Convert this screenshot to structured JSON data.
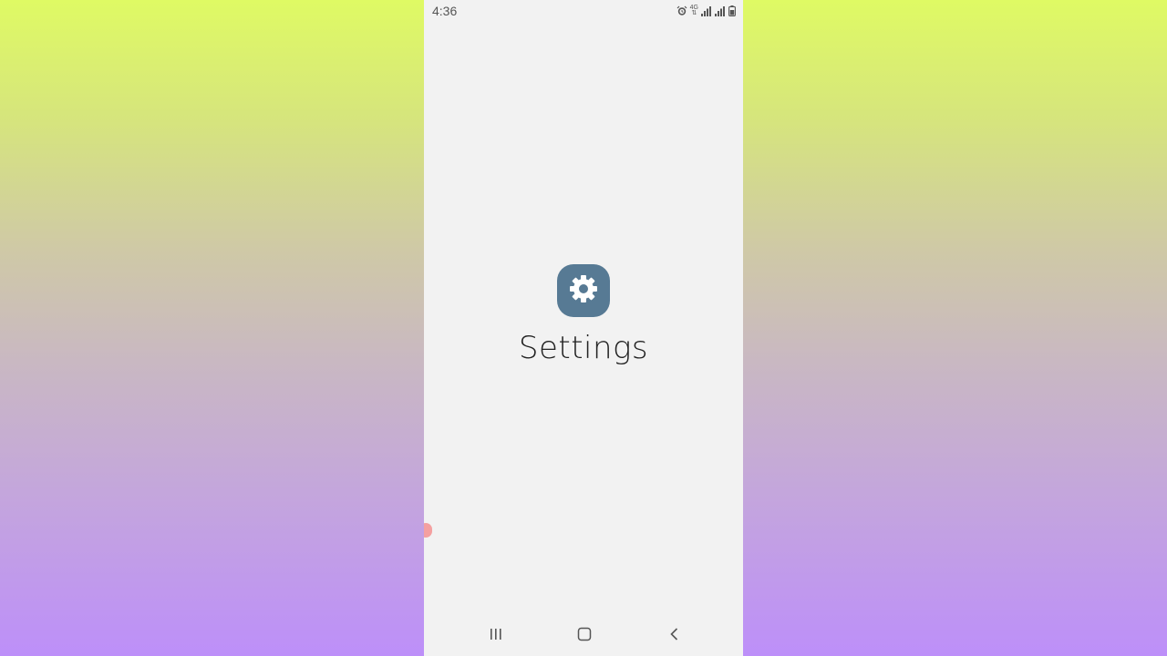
{
  "status_bar": {
    "time": "4:36",
    "icons": [
      "alarm-icon",
      "network-4g-icon",
      "signal-icon",
      "signal-icon",
      "battery-icon"
    ],
    "network_label_top": "4G",
    "network_label_bottom": "⇅"
  },
  "splash": {
    "app_icon": "gear-icon",
    "app_name": "Settings",
    "icon_color": "#577a94"
  },
  "nav_bar": {
    "buttons": [
      "recents-icon",
      "home-icon",
      "back-icon"
    ]
  }
}
